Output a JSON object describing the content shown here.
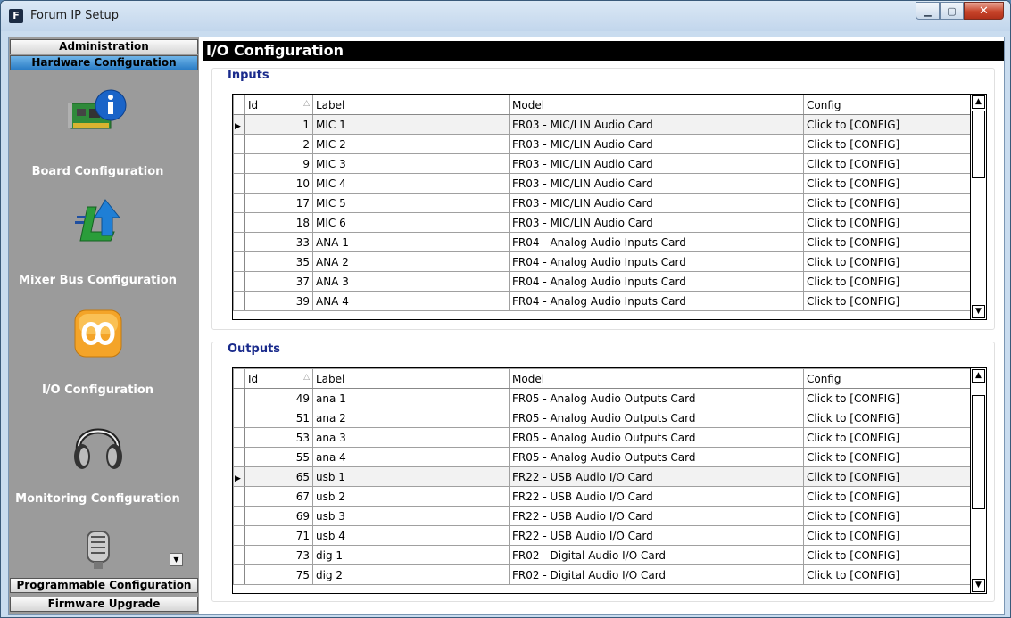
{
  "window": {
    "title": "Forum IP Setup",
    "icon_letter": "F"
  },
  "nav": {
    "headers": {
      "administration": "Administration",
      "hardware": "Hardware Configuration",
      "programmable": "Programmable Configuration",
      "firmware": "Firmware Upgrade"
    },
    "items": [
      {
        "label": "Board Configuration",
        "icon": "board-icon"
      },
      {
        "label": "Mixer Bus Configuration",
        "icon": "mixer-icon"
      },
      {
        "label": "I/O Configuration",
        "icon": "io-icon"
      },
      {
        "label": "Monitoring Configuration",
        "icon": "headphones-icon"
      },
      {
        "label": "",
        "icon": "microphone-icon"
      }
    ]
  },
  "main": {
    "title": "I/O Configuration",
    "inputs": {
      "title": "Inputs",
      "columns": {
        "id": "Id",
        "label": "Label",
        "model": "Model",
        "config": "Config"
      },
      "rows": [
        {
          "id": "1",
          "label": "MIC 1",
          "model": "FR03 - MIC/LIN Audio Card",
          "config": "Click to [CONFIG]"
        },
        {
          "id": "2",
          "label": "MIC 2",
          "model": "FR03 - MIC/LIN Audio Card",
          "config": "Click to [CONFIG]"
        },
        {
          "id": "9",
          "label": "MIC 3",
          "model": "FR03 - MIC/LIN Audio Card",
          "config": "Click to [CONFIG]"
        },
        {
          "id": "10",
          "label": "MIC 4",
          "model": "FR03 - MIC/LIN Audio Card",
          "config": "Click to [CONFIG]"
        },
        {
          "id": "17",
          "label": "MIC 5",
          "model": "FR03 - MIC/LIN Audio Card",
          "config": "Click to [CONFIG]"
        },
        {
          "id": "18",
          "label": "MIC 6",
          "model": "FR03 - MIC/LIN Audio Card",
          "config": "Click to [CONFIG]"
        },
        {
          "id": "33",
          "label": "ANA 1",
          "model": "FR04 - Analog Audio Inputs Card",
          "config": "Click to [CONFIG]"
        },
        {
          "id": "35",
          "label": "ANA 2",
          "model": "FR04 - Analog Audio Inputs Card",
          "config": "Click to [CONFIG]"
        },
        {
          "id": "37",
          "label": "ANA 3",
          "model": "FR04 - Analog Audio Inputs Card",
          "config": "Click to [CONFIG]"
        },
        {
          "id": "39",
          "label": "ANA 4",
          "model": "FR04 - Analog Audio Inputs Card",
          "config": "Click to [CONFIG]"
        }
      ]
    },
    "outputs": {
      "title": "Outputs",
      "columns": {
        "id": "Id",
        "label": "Label",
        "model": "Model",
        "config": "Config"
      },
      "rows": [
        {
          "id": "49",
          "label": "ana 1",
          "model": "FR05 - Analog Audio Outputs Card",
          "config": "Click to [CONFIG]"
        },
        {
          "id": "51",
          "label": "ana 2",
          "model": "FR05 - Analog Audio Outputs Card",
          "config": "Click to [CONFIG]"
        },
        {
          "id": "53",
          "label": "ana 3",
          "model": "FR05 - Analog Audio Outputs Card",
          "config": "Click to [CONFIG]"
        },
        {
          "id": "55",
          "label": "ana 4",
          "model": "FR05 - Analog Audio Outputs Card",
          "config": "Click to [CONFIG]"
        },
        {
          "id": "65",
          "label": "usb 1",
          "model": "FR22 - USB Audio I/O Card",
          "config": "Click to [CONFIG]"
        },
        {
          "id": "67",
          "label": "usb 2",
          "model": "FR22 - USB Audio I/O Card",
          "config": "Click to [CONFIG]"
        },
        {
          "id": "69",
          "label": "usb 3",
          "model": "FR22 - USB Audio I/O Card",
          "config": "Click to [CONFIG]"
        },
        {
          "id": "71",
          "label": "usb 4",
          "model": "FR22 - USB Audio I/O Card",
          "config": "Click to [CONFIG]"
        },
        {
          "id": "73",
          "label": "dig 1",
          "model": "FR02 - Digital Audio I/O Card",
          "config": "Click to [CONFIG]"
        },
        {
          "id": "75",
          "label": "dig 2",
          "model": "FR02 - Digital Audio I/O Card",
          "config": "Click to [CONFIG]"
        }
      ]
    }
  }
}
